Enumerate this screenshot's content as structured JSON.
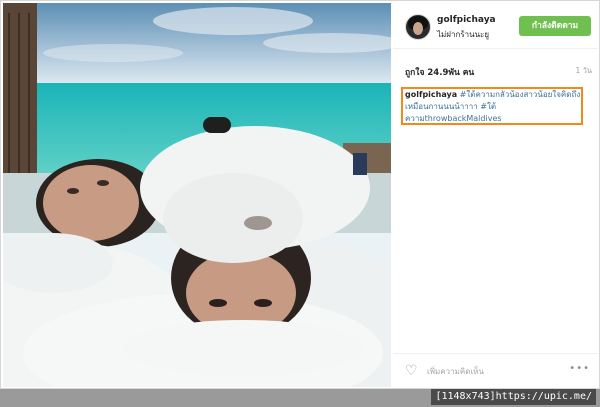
{
  "post": {
    "username": "golfpichaya",
    "location": "ไม่ฝากร้านนะยู",
    "follow_label": "กำลังติดตาม",
    "likes": "ถูกใจ 24.9พัน คน",
    "time_ago": "1 วัน",
    "caption": {
      "user": "golfpichaya",
      "tag1": "#ใต้ความกลัวน้องสาวน้อยใจคิดถึงเหมือนกานนนน้าาาา",
      "tag2": "#ใต้ความthrowbackMaldives"
    },
    "caption_lines": [
      "golfpichaya #ใต้ความกลัวน้องสาวน้อยใจ",
      "คิดถึงเหมือนกานนนน้าาาา #ใต้",
      "ความthrowbackMaldives"
    ]
  },
  "comment": {
    "placeholder": "เพิ่มความคิดเห็น",
    "like_icon": "heart-outline-icon",
    "more_label": "•••"
  },
  "watermark": "[1148x743]https://upic.me/",
  "colors": {
    "follow_button": "#70c050",
    "hashtag": "#3f729b",
    "highlight_box": "#f08a1c"
  }
}
